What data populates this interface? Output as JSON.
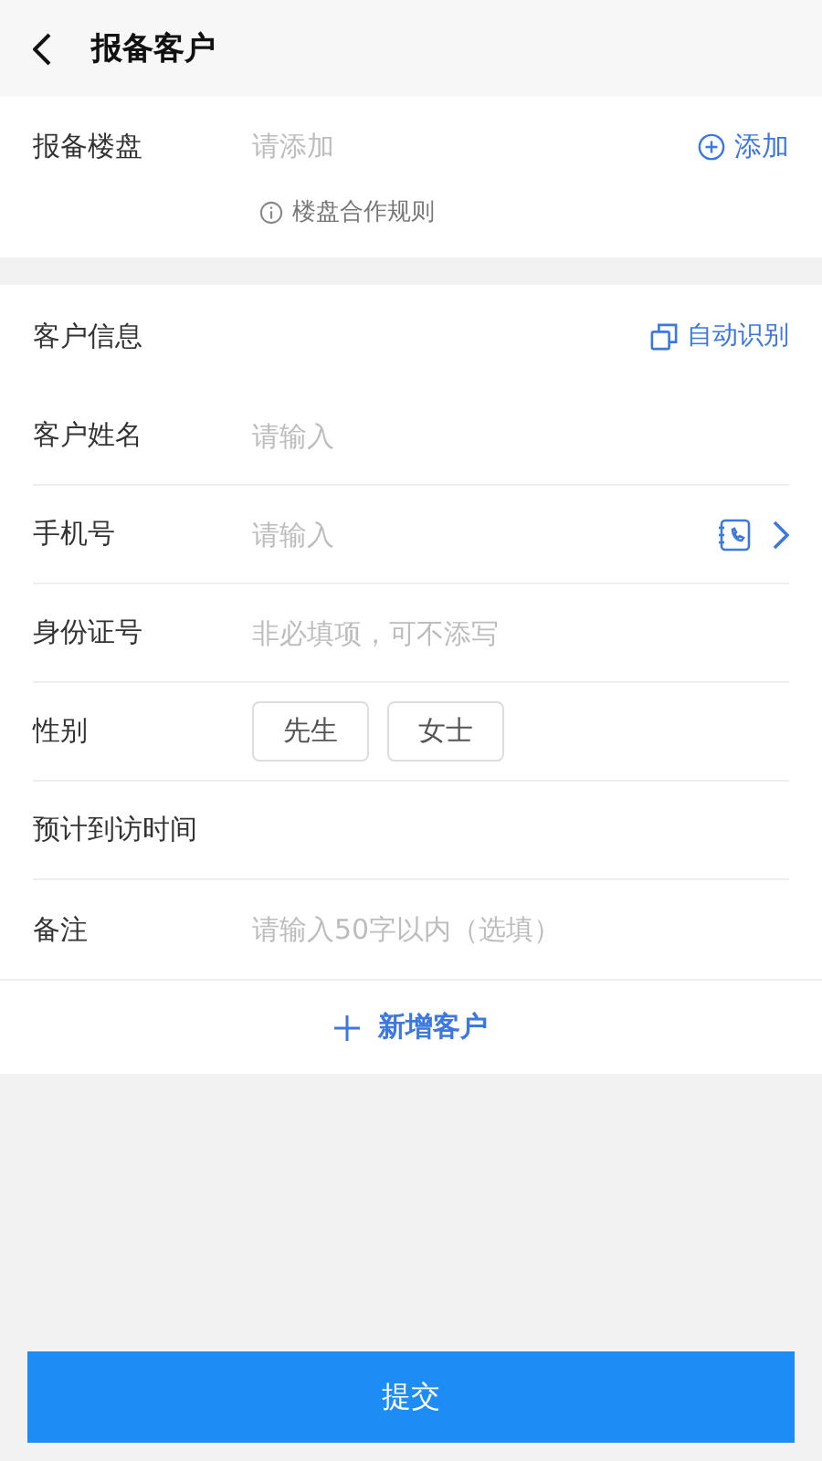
{
  "header": {
    "title": "报备客户"
  },
  "project": {
    "label": "报备楼盘",
    "placeholder": "请添加",
    "action": "添加",
    "rule_link": "楼盘合作规则"
  },
  "customer": {
    "title": "客户信息",
    "action": "自动识别",
    "fields": [
      {
        "kind": "input",
        "label": "客户姓名",
        "placeholder": "请输入"
      },
      {
        "kind": "phone",
        "label": "手机号",
        "placeholder": "请输入"
      },
      {
        "kind": "input",
        "label": "身份证号",
        "placeholder": "非必填项，可不添写"
      },
      {
        "kind": "options",
        "label": "性别",
        "options": [
          {
            "label": "先生",
            "selected": false
          },
          {
            "label": "女士",
            "selected": false
          }
        ]
      },
      {
        "kind": "empty",
        "label": "预计到访时间"
      },
      {
        "kind": "input",
        "label": "备注",
        "placeholder": "请输入50字以内（选填）"
      }
    ],
    "add_button": "新增客户"
  },
  "submit": "提交"
}
